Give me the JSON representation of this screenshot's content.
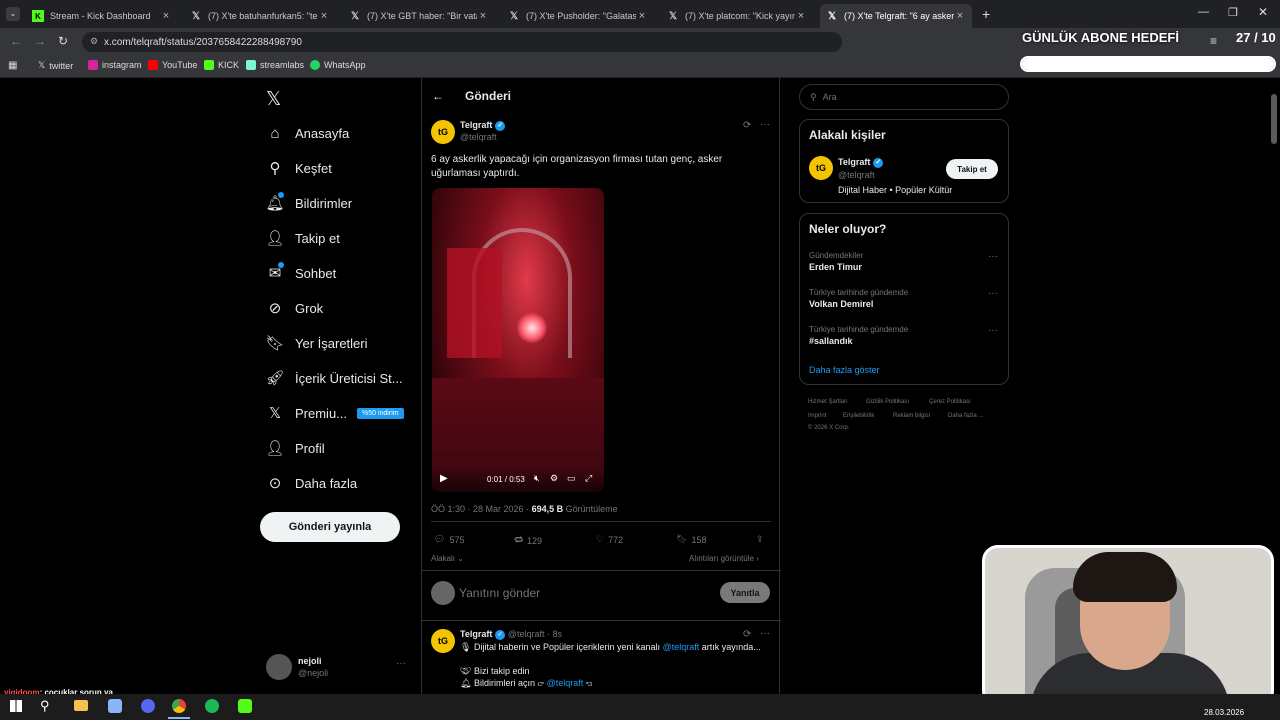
{
  "browser": {
    "tabs": [
      {
        "title": "Stream - Kick Dashboard",
        "icon": "kick-icon"
      },
      {
        "title": "(7) X'te batuhanfurkan5: \"telefo",
        "icon": "x-icon"
      },
      {
        "title": "(7) X'te GBT haber: \"Bir vatanda",
        "icon": "x-icon"
      },
      {
        "title": "(7) X'te Pusholder: \"Galatasaray",
        "icon": "x-icon"
      },
      {
        "title": "(7) X'te platcom: \"Kick yayıncısı",
        "icon": "x-icon"
      },
      {
        "title": "(7) X'te Telgraft: \"6 ay askerlik y",
        "icon": "x-icon"
      }
    ],
    "new_tab": "+",
    "url": "x.com/telqraft/status/2037658422288498790",
    "bookmarks": [
      "twitter",
      "instagram",
      "YouTube",
      "KICK",
      "streamlabs",
      "WhatsApp"
    ]
  },
  "overlay": {
    "goal_title": "GÜNLÜK ABONE HEDEFİ",
    "goal_count": "27 / 10",
    "goal_progress": 1.0
  },
  "nav": {
    "items": [
      "Anasayfa",
      "Keşfet",
      "Bildirimler",
      "Takip et",
      "Sohbet",
      "Grok",
      "Yer İşaretleri",
      "İçerik Üreticisi St...",
      "Premiu...",
      "Profil",
      "Daha fazla"
    ],
    "premium_badge": "%50 indirim",
    "post_button": "Gönderi yayınla",
    "account_name": "nejoli",
    "account_handle": "@nejoli"
  },
  "post": {
    "header": "Gönderi",
    "author": "Telgraft",
    "handle": "@telqraft",
    "text": "6 ay askerlik yapacağı için organizasyon firması tutan genç, asker uğurlaması yaptırdı.",
    "video_time": "0:01 / 0:53",
    "meta_time": "ÖÖ 1:30 · 28 Mar 2026 ·",
    "views": "694,5 B",
    "views_label": "Görüntüleme",
    "replies": "575",
    "reposts": "129",
    "likes": "772",
    "bookmarks": "158",
    "related": "Alakalı",
    "quotes": "Alıntıları görüntüle",
    "reply_placeholder": "Yanıtını gönder",
    "reply_button": "Yanıtla"
  },
  "reply_post": {
    "author": "Telgraft",
    "handle": "@telqraft",
    "age": "8s",
    "line1_pre": "Dijital haberin ve Popüler içeriklerin yeni kanalı",
    "line1_mention": "@telqraft",
    "line1_post": "artık yayında...",
    "line2": "Bizi takip edin",
    "line3_pre": "Bildirimleri açın",
    "line3_mention": "@telqraft"
  },
  "right": {
    "search_placeholder": "Ara",
    "related_title": "Alakalı kişiler",
    "person_name": "Telgraft",
    "person_handle": "@telqraft",
    "person_bio": "Dijital Haber • Popüler Kültür",
    "follow_button": "Takip et",
    "trends_title": "Neler oluyor?",
    "trends": [
      {
        "category": "Gündemdekiler",
        "name": "Erden Timur"
      },
      {
        "category": "Türkiye tarihinde gündemde",
        "name": "Volkan Demirel"
      },
      {
        "category": "Türkiye tarihinde gündemde",
        "name": "#sallandık"
      }
    ],
    "show_more": "Daha fazla göster",
    "footer": [
      "Hizmet Şartları",
      "Gizlilik Politikası",
      "Çerez Politikası",
      "Imprint",
      "Erişilebilirlik",
      "Reklam bilgisi",
      "Daha fazla ...",
      "© 2026 X Corp."
    ]
  },
  "chat": {
    "user": "yigidoom",
    "message": ": çocuklar sorun ya"
  },
  "taskbar": {
    "date": "28.03.2026"
  },
  "colors": {
    "accent": "#1d9bf0",
    "telgraft_yellow": "#f5c400",
    "kick_green": "#53fc18"
  }
}
